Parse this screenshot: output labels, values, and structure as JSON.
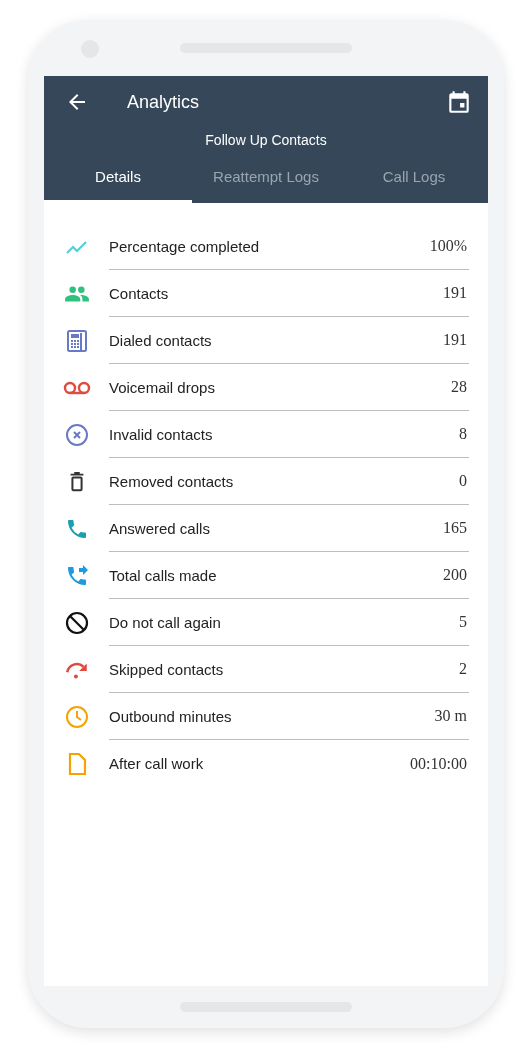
{
  "app_bar": {
    "title": "Analytics",
    "subtitle": "Follow Up Contacts"
  },
  "tabs": [
    {
      "label": "Details",
      "selected": true
    },
    {
      "label": "Reattempt Logs",
      "selected": false
    },
    {
      "label": "Call Logs",
      "selected": false
    }
  ],
  "stats": [
    {
      "label": "Percentage completed",
      "value": "100%"
    },
    {
      "label": "Contacts",
      "value": "191"
    },
    {
      "label": "Dialed contacts",
      "value": "191"
    },
    {
      "label": "Voicemail drops",
      "value": "28"
    },
    {
      "label": "Invalid contacts",
      "value": "8"
    },
    {
      "label": "Removed contacts",
      "value": "0"
    },
    {
      "label": "Answered calls",
      "value": "165"
    },
    {
      "label": "Total calls made",
      "value": "200"
    },
    {
      "label": "Do not call again",
      "value": "5"
    },
    {
      "label": "Skipped contacts",
      "value": "2"
    },
    {
      "label": "Outbound minutes",
      "value": "30 m"
    },
    {
      "label": "After call work",
      "value": "00:10:00"
    }
  ]
}
